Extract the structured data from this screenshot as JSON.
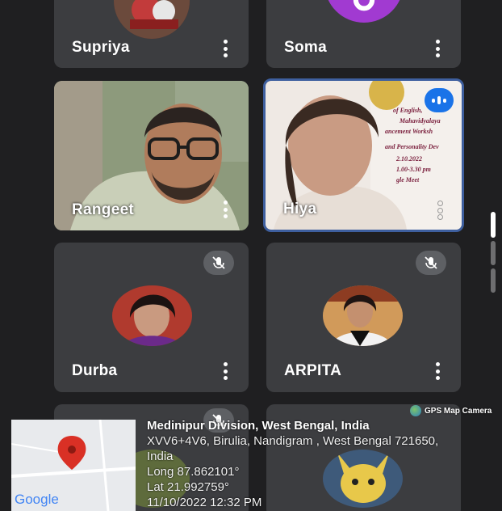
{
  "participants": [
    {
      "name": "Supriya",
      "muted": false
    },
    {
      "name": "Soma",
      "muted": false
    },
    {
      "name": "Rangeet",
      "muted": false
    },
    {
      "name": "Hiya",
      "muted": false,
      "speaking": true
    },
    {
      "name": "Durba",
      "muted": true
    },
    {
      "name": "ARPITA",
      "muted": true
    }
  ],
  "hiya_background_text": [
    "of English,",
    "Mahavidyalaya",
    "ancement Worksh",
    "and Personality Dev",
    "2.10.2022",
    "1.00-3.30 pm",
    "gle Meet"
  ],
  "gps": {
    "badge": "GPS Map Camera",
    "map_logo": "Google",
    "title": "Medinipur Division, West Bengal, India",
    "address_line1": "XVV6+4V6, Birulia, Nandigram , West Bengal 721650,",
    "address_line2": "India",
    "long": "Long 87.862101°",
    "lat": "Lat 21.992759°",
    "datetime": "11/10/2022 12:32 PM"
  },
  "colors": {
    "tile_bg": "#3c3d40",
    "page_bg": "#1f1f21",
    "active_border": "#3e5f9f",
    "soma_avatar": "#a13ad1",
    "speaking_badge": "#1a73e8",
    "map_pin": "#d93025"
  }
}
